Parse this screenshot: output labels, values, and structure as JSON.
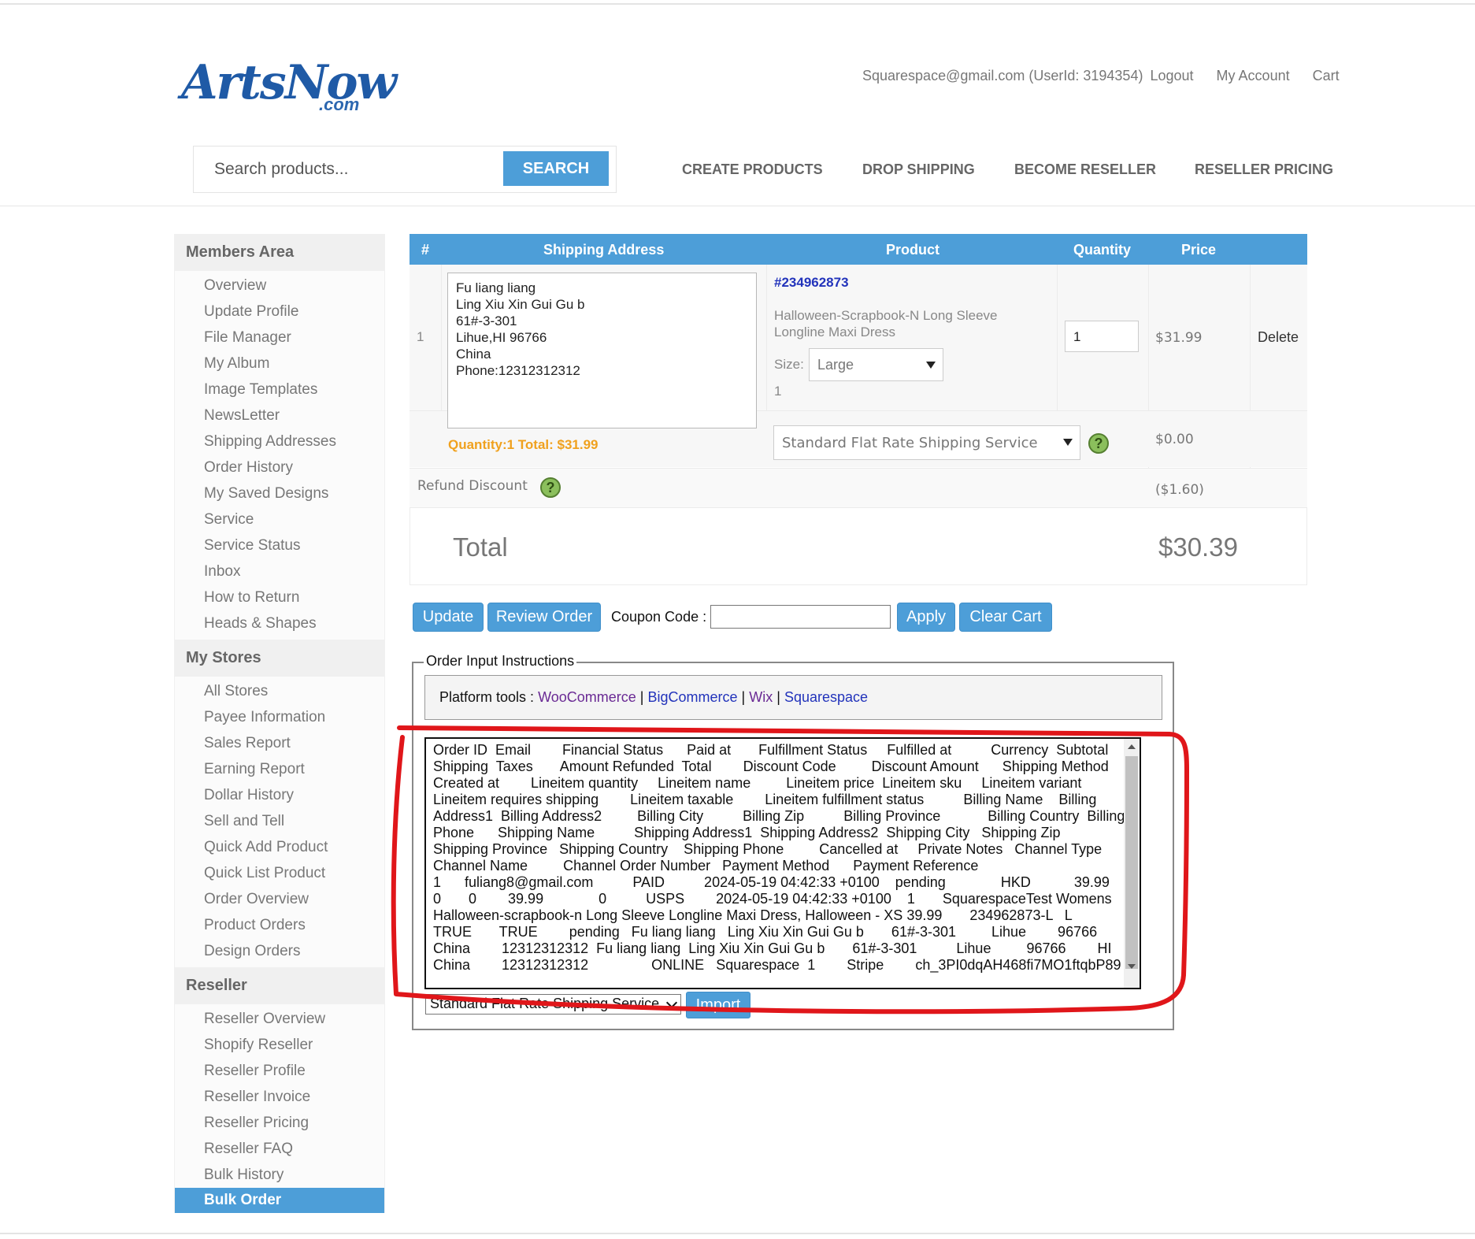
{
  "logo": {
    "brand_a": "Arts",
    "brand_b": "Now",
    "brand_c": ".com"
  },
  "header": {
    "user": "Squarespace@gmail.com (UserId: 3194354)",
    "logout": "Logout",
    "my_account": "My Account",
    "cart": "Cart"
  },
  "search": {
    "placeholder": "Search products...",
    "button": "SEARCH"
  },
  "nav": [
    "CREATE PRODUCTS",
    "DROP SHIPPING",
    "BECOME RESELLER",
    "RESELLER PRICING"
  ],
  "sidebar": {
    "members": {
      "title": "Members Area",
      "items": [
        "Overview",
        "Update Profile",
        "File Manager",
        "My Album",
        "Image Templates",
        "NewsLetter",
        "Shipping Addresses",
        "Order History",
        "My Saved Designs",
        "Service",
        "Service Status",
        "Inbox",
        "How to Return",
        "Heads & Shapes"
      ]
    },
    "stores": {
      "title": "My Stores",
      "items": [
        "All Stores",
        "Payee Information",
        "Sales Report",
        "Earning Report",
        "Dollar History",
        "Sell and Tell",
        "Quick Add Product",
        "Quick List Product",
        "Order Overview",
        "Product Orders",
        "Design Orders"
      ]
    },
    "reseller": {
      "title": "Reseller",
      "items": [
        "Reseller Overview",
        "Shopify Reseller",
        "Reseller Profile",
        "Reseller Invoice",
        "Reseller Pricing",
        "Reseller FAQ",
        "Bulk History",
        "Bulk Order"
      ],
      "active": "Bulk Order"
    }
  },
  "cart": {
    "columns": [
      "#",
      "Shipping Address",
      "Product",
      "Quantity",
      "Price"
    ],
    "row": {
      "index": "1",
      "address": "Fu liang liang\nLing Xiu Xin Gui Gu b\n61#-3-301\nLihue,HI 96766\nChina\nPhone:12312312312",
      "qty_total": "Quantity:1 Total: $31.99",
      "product_id": "#234962873",
      "product_name": "Halloween-Scrapbook-N Long Sleeve Longline Maxi Dress",
      "size_label": "Size:",
      "size_value": "Large",
      "size_qty": "1",
      "quantity": "1",
      "price": "$31.99",
      "delete": "Delete"
    },
    "shipping": {
      "method": "Standard Flat Rate Shipping Service",
      "price": "$0.00"
    },
    "refund": {
      "label": "Refund Discount",
      "value": "($1.60)"
    },
    "total": {
      "label": "Total",
      "value": "$30.39"
    }
  },
  "actions": {
    "update": "Update",
    "review": "Review Order",
    "coupon_label": "Coupon Code :",
    "apply": "Apply",
    "clear": "Clear Cart"
  },
  "instructions": {
    "legend": "Order Input Instructions",
    "platform_label": "Platform tools :",
    "platforms": [
      "WooCommerce",
      "BigCommerce",
      "Wix",
      "Squarespace"
    ],
    "separator": "|",
    "textarea": "Order ID  Email        Financial Status      Paid at       Fulfillment Status     Fulfilled at          Currency  Subtotal\nShipping  Taxes       Amount Refunded  Total        Discount Code         Discount Amount      Shipping Method\nCreated at        Lineitem quantity     Lineitem name         Lineitem price  Lineitem sku     Lineitem variant\nLineitem requires shipping        Lineitem taxable        Lineitem fulfillment status          Billing Name    Billing\nAddress1  Billing Address2         Billing City          Billing Zip          Billing Province            Billing Country  Billing\nPhone      Shipping Name          Shipping Address1  Shipping Address2  Shipping City   Shipping Zip\nShipping Province   Shipping Country    Shipping Phone         Cancelled at     Private Notes   Channel Type\nChannel Name         Channel Order Number   Payment Method      Payment Reference\n1      fuliang8@gmail.com          PAID          2024-05-19 04:42:33 +0100    pending              HKD           39.99          0\n0       0        39.99              0          USPS        2024-05-19 04:42:33 +0100    1       SquarespaceTest Womens\nHalloween-scrapbook-n Long Sleeve Longline Maxi Dress, Halloween - XS 39.99       234962873-L   L\nTRUE       TRUE        pending   Fu liang liang   Ling Xiu Xin Gui Gu b       61#-3-301         Lihue        96766         HI\nChina        12312312312  Fu liang liang  Ling Xiu Xin Gui Gu b       61#-3-301          Lihue         96766        HI\nChina        12312312312                ONLINE   Squarespace  1        Stripe        ch_3PI0dqAH468fi7MO1ftqbP89",
    "ship_select": "Standard Flat Rate Shipping Service",
    "import": "Import"
  },
  "colors": {
    "accent": "#4d9ed8",
    "highlight_stroke": "#e0161a",
    "orange": "#f0a11e",
    "link": "#2233bb"
  }
}
